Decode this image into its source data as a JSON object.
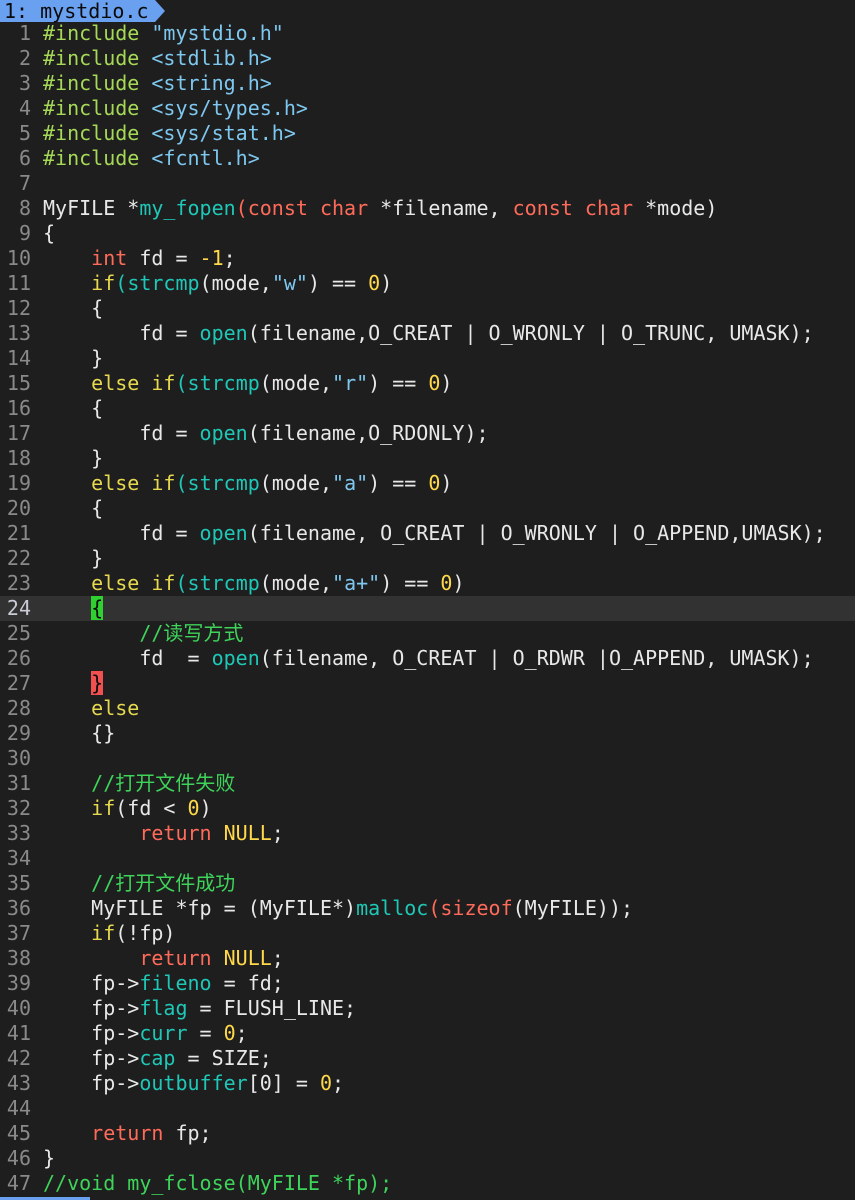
{
  "tab": {
    "label": "1: mystdio.c"
  },
  "colors": {
    "background": "#1e1e1e",
    "tab_active": "#6aa0f0",
    "cursorline": "#323232",
    "line_number": "#8a8a8a",
    "preprocessor": "#a6d957",
    "include_path": "#7ec8f0",
    "type": "#ff6b5a",
    "keyword": "#e6d84f",
    "function": "#1fc7b7",
    "string": "#7ec8f0",
    "number": "#ffd94a",
    "comment": "#3ed35a",
    "match_open": "#2fd02f",
    "match_close": "#f05050"
  },
  "editor": {
    "cursor_line": 24,
    "lines": [
      {
        "n": "1",
        "tokens": [
          [
            "pre",
            "#include"
          ],
          [
            "norm",
            " "
          ],
          [
            "inc",
            "\"mystdio.h\""
          ]
        ]
      },
      {
        "n": "2",
        "tokens": [
          [
            "pre",
            "#include"
          ],
          [
            "norm",
            " "
          ],
          [
            "inc",
            "<stdlib.h>"
          ]
        ]
      },
      {
        "n": "3",
        "tokens": [
          [
            "pre",
            "#include"
          ],
          [
            "norm",
            " "
          ],
          [
            "inc",
            "<string.h>"
          ]
        ]
      },
      {
        "n": "4",
        "tokens": [
          [
            "pre",
            "#include"
          ],
          [
            "norm",
            " "
          ],
          [
            "inc",
            "<sys/types.h>"
          ]
        ]
      },
      {
        "n": "5",
        "tokens": [
          [
            "pre",
            "#include"
          ],
          [
            "norm",
            " "
          ],
          [
            "inc",
            "<sys/stat.h>"
          ]
        ]
      },
      {
        "n": "6",
        "tokens": [
          [
            "pre",
            "#include"
          ],
          [
            "norm",
            " "
          ],
          [
            "inc",
            "<fcntl.h>"
          ]
        ]
      },
      {
        "n": "7",
        "tokens": []
      },
      {
        "n": "8",
        "tokens": [
          [
            "norm",
            "MyFILE *"
          ],
          [
            "fn",
            "my_fopen"
          ],
          [
            "pink",
            "("
          ],
          [
            "type",
            "const"
          ],
          [
            "norm",
            " "
          ],
          [
            "type",
            "char"
          ],
          [
            "norm",
            " *filename, "
          ],
          [
            "type",
            "const"
          ],
          [
            "norm",
            " "
          ],
          [
            "type",
            "char"
          ],
          [
            "norm",
            " *mode)"
          ]
        ]
      },
      {
        "n": "9",
        "tokens": [
          [
            "norm",
            "{"
          ]
        ]
      },
      {
        "n": "10",
        "tokens": [
          [
            "norm",
            "    "
          ],
          [
            "type",
            "int"
          ],
          [
            "norm",
            " fd = "
          ],
          [
            "num",
            "-1"
          ],
          [
            "norm",
            ";"
          ]
        ]
      },
      {
        "n": "11",
        "tokens": [
          [
            "norm",
            "    "
          ],
          [
            "key",
            "if"
          ],
          [
            "fn",
            "("
          ],
          [
            "fn",
            "strcmp"
          ],
          [
            "norm",
            "(mode,"
          ],
          [
            "str",
            "\"w\""
          ],
          [
            "norm",
            ") == "
          ],
          [
            "num",
            "0"
          ],
          [
            "norm",
            ")"
          ]
        ]
      },
      {
        "n": "12",
        "tokens": [
          [
            "norm",
            "    {"
          ]
        ]
      },
      {
        "n": "13",
        "tokens": [
          [
            "norm",
            "        fd = "
          ],
          [
            "fn",
            "open"
          ],
          [
            "norm",
            "(filename,O_CREAT | O_WRONLY | O_TRUNC, UMASK);"
          ]
        ]
      },
      {
        "n": "14",
        "tokens": [
          [
            "norm",
            "    }"
          ]
        ]
      },
      {
        "n": "15",
        "tokens": [
          [
            "norm",
            "    "
          ],
          [
            "key",
            "else"
          ],
          [
            "norm",
            " "
          ],
          [
            "key",
            "if"
          ],
          [
            "fn",
            "("
          ],
          [
            "fn",
            "strcmp"
          ],
          [
            "norm",
            "(mode,"
          ],
          [
            "str",
            "\"r\""
          ],
          [
            "norm",
            ") == "
          ],
          [
            "num",
            "0"
          ],
          [
            "norm",
            ")"
          ]
        ]
      },
      {
        "n": "16",
        "tokens": [
          [
            "norm",
            "    {"
          ]
        ]
      },
      {
        "n": "17",
        "tokens": [
          [
            "norm",
            "        fd = "
          ],
          [
            "fn",
            "open"
          ],
          [
            "norm",
            "(filename,O_RDONLY);"
          ]
        ]
      },
      {
        "n": "18",
        "tokens": [
          [
            "norm",
            "    }"
          ]
        ]
      },
      {
        "n": "19",
        "tokens": [
          [
            "norm",
            "    "
          ],
          [
            "key",
            "else"
          ],
          [
            "norm",
            " "
          ],
          [
            "key",
            "if"
          ],
          [
            "fn",
            "("
          ],
          [
            "fn",
            "strcmp"
          ],
          [
            "norm",
            "(mode,"
          ],
          [
            "str",
            "\"a\""
          ],
          [
            "norm",
            ") == "
          ],
          [
            "num",
            "0"
          ],
          [
            "norm",
            ")"
          ]
        ]
      },
      {
        "n": "20",
        "tokens": [
          [
            "norm",
            "    {"
          ]
        ]
      },
      {
        "n": "21",
        "tokens": [
          [
            "norm",
            "        fd = "
          ],
          [
            "fn",
            "open"
          ],
          [
            "norm",
            "(filename, O_CREAT | O_WRONLY | O_APPEND,UMASK);"
          ]
        ]
      },
      {
        "n": "22",
        "tokens": [
          [
            "norm",
            "    }"
          ]
        ]
      },
      {
        "n": "23",
        "tokens": [
          [
            "norm",
            "    "
          ],
          [
            "key",
            "else"
          ],
          [
            "norm",
            " "
          ],
          [
            "key",
            "if"
          ],
          [
            "fn",
            "("
          ],
          [
            "fn",
            "strcmp"
          ],
          [
            "norm",
            "(mode,"
          ],
          [
            "str",
            "\"a+\""
          ],
          [
            "norm",
            ") == "
          ],
          [
            "num",
            "0"
          ],
          [
            "norm",
            ")"
          ]
        ]
      },
      {
        "n": "24",
        "tokens": [
          [
            "norm",
            "    "
          ],
          [
            "matchopen",
            "{"
          ]
        ]
      },
      {
        "n": "25",
        "tokens": [
          [
            "norm",
            "        "
          ],
          [
            "cm",
            "//读写方式"
          ]
        ]
      },
      {
        "n": "26",
        "tokens": [
          [
            "norm",
            "        fd  = "
          ],
          [
            "fn",
            "open"
          ],
          [
            "norm",
            "(filename, O_CREAT | O_RDWR |O_APPEND, UMASK);"
          ]
        ]
      },
      {
        "n": "27",
        "tokens": [
          [
            "norm",
            "    "
          ],
          [
            "matchclose",
            "}"
          ]
        ]
      },
      {
        "n": "28",
        "tokens": [
          [
            "norm",
            "    "
          ],
          [
            "key",
            "else"
          ]
        ]
      },
      {
        "n": "29",
        "tokens": [
          [
            "norm",
            "    {}"
          ]
        ]
      },
      {
        "n": "30",
        "tokens": []
      },
      {
        "n": "31",
        "tokens": [
          [
            "norm",
            "    "
          ],
          [
            "cm",
            "//打开文件失败"
          ]
        ]
      },
      {
        "n": "32",
        "tokens": [
          [
            "norm",
            "    "
          ],
          [
            "key",
            "if"
          ],
          [
            "norm",
            "(fd < "
          ],
          [
            "num",
            "0"
          ],
          [
            "norm",
            ")"
          ]
        ]
      },
      {
        "n": "33",
        "tokens": [
          [
            "norm",
            "        "
          ],
          [
            "type",
            "return"
          ],
          [
            "norm",
            " "
          ],
          [
            "null",
            "NULL"
          ],
          [
            "norm",
            ";"
          ]
        ]
      },
      {
        "n": "34",
        "tokens": []
      },
      {
        "n": "35",
        "tokens": [
          [
            "norm",
            "    "
          ],
          [
            "cm",
            "//打开文件成功"
          ]
        ]
      },
      {
        "n": "36",
        "tokens": [
          [
            "norm",
            "    MyFILE *fp = (MyFILE*)"
          ],
          [
            "fn",
            "malloc"
          ],
          [
            "pink",
            "("
          ],
          [
            "type",
            "sizeof"
          ],
          [
            "norm",
            "(MyFILE));"
          ]
        ]
      },
      {
        "n": "37",
        "tokens": [
          [
            "norm",
            "    "
          ],
          [
            "key",
            "if"
          ],
          [
            "norm",
            "(!fp)"
          ]
        ]
      },
      {
        "n": "38",
        "tokens": [
          [
            "norm",
            "        "
          ],
          [
            "type",
            "return"
          ],
          [
            "norm",
            " "
          ],
          [
            "null",
            "NULL"
          ],
          [
            "norm",
            ";"
          ]
        ]
      },
      {
        "n": "39",
        "tokens": [
          [
            "norm",
            "    fp->"
          ],
          [
            "field",
            "fileno"
          ],
          [
            "norm",
            " = fd;"
          ]
        ]
      },
      {
        "n": "40",
        "tokens": [
          [
            "norm",
            "    fp->"
          ],
          [
            "field",
            "flag"
          ],
          [
            "norm",
            " = FLUSH_LINE;"
          ]
        ]
      },
      {
        "n": "41",
        "tokens": [
          [
            "norm",
            "    fp->"
          ],
          [
            "field",
            "curr"
          ],
          [
            "norm",
            " = "
          ],
          [
            "num",
            "0"
          ],
          [
            "norm",
            ";"
          ]
        ]
      },
      {
        "n": "42",
        "tokens": [
          [
            "norm",
            "    fp->"
          ],
          [
            "field",
            "cap"
          ],
          [
            "norm",
            " = SIZE;"
          ]
        ]
      },
      {
        "n": "43",
        "tokens": [
          [
            "norm",
            "    fp->"
          ],
          [
            "field",
            "outbuffer"
          ],
          [
            "norm",
            "["
          ],
          [
            "norm",
            "0"
          ],
          [
            "norm",
            "] = "
          ],
          [
            "num",
            "0"
          ],
          [
            "norm",
            ";"
          ]
        ]
      },
      {
        "n": "44",
        "tokens": []
      },
      {
        "n": "45",
        "tokens": [
          [
            "norm",
            "    "
          ],
          [
            "type",
            "return"
          ],
          [
            "norm",
            " fp;"
          ]
        ]
      },
      {
        "n": "46",
        "tokens": [
          [
            "norm",
            "}"
          ]
        ]
      },
      {
        "n": "47",
        "tokens": [
          [
            "cm",
            "//void my_fclose(MyFILE *fp);"
          ]
        ]
      }
    ]
  }
}
